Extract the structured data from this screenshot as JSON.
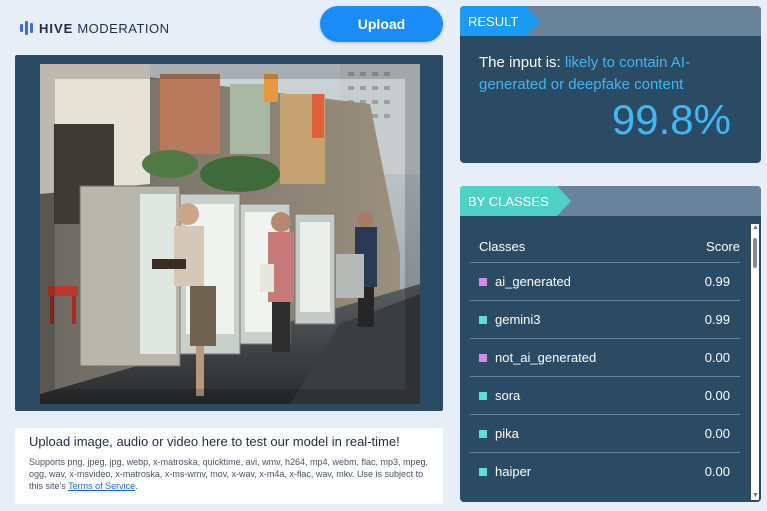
{
  "header": {
    "brand": "HIVE",
    "brand_sub": "MODERATION",
    "upload_label": "Upload"
  },
  "uploader": {
    "title": "Upload image, audio or video here to test our model in real-time!",
    "description": "Supports png, jpeg, jpg, webp, x-matroska, quicktime, avi, wmv, h264, mp4, webm, flac, mp3, mpeg, ogg, wav, x-msvideo, x-matroska, x-ms-wmv, mov, x-wav, x-m4a, x-flac, wav, mkv. Use is subject to this site's",
    "terms_link": "Terms of Service",
    "terms_suffix": "."
  },
  "result": {
    "tag": "RESULT",
    "prefix": "The input is:",
    "verdict": "likely to contain AI-generated or deepfake content",
    "score": "99.8%"
  },
  "classes": {
    "tag": "BY CLASSES",
    "col_class": "Classes",
    "col_score": "Score",
    "rows": [
      {
        "name": "ai_generated",
        "score": "0.99",
        "color": "#d88be6"
      },
      {
        "name": "gemini3",
        "score": "0.99",
        "color": "#5fe0d4"
      },
      {
        "name": "not_ai_generated",
        "score": "0.00",
        "color": "#d88be6"
      },
      {
        "name": "sora",
        "score": "0.00",
        "color": "#5fe0d4"
      },
      {
        "name": "pika",
        "score": "0.00",
        "color": "#5fe0d4"
      },
      {
        "name": "haiper",
        "score": "0.00",
        "color": "#5fe0d4"
      }
    ]
  },
  "colors": {
    "accent": "#1a8cf7",
    "panel": "#2b4a63",
    "highlight": "#3fb8f5",
    "classes_tag": "#4fd1c5"
  }
}
